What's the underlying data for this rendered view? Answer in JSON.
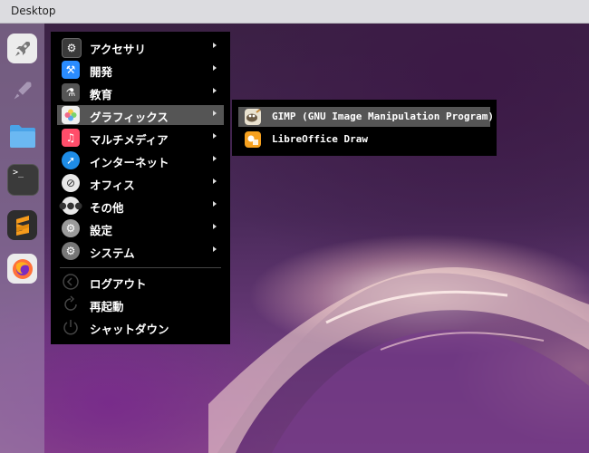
{
  "window": {
    "title": "Desktop"
  },
  "dock": {
    "items": [
      {
        "name": "launcher",
        "icon": "rocket-icon"
      },
      {
        "name": "rocket-ghost",
        "icon": "rocket-icon"
      },
      {
        "name": "files",
        "icon": "folder-icon"
      },
      {
        "name": "terminal",
        "icon": "terminal-icon",
        "glyph": ">_"
      },
      {
        "name": "sublime-text",
        "icon": "sublime-icon"
      },
      {
        "name": "firefox",
        "icon": "firefox-icon"
      }
    ]
  },
  "menu": {
    "items": [
      {
        "label": "アクセサリ",
        "icon": "accessories-icon",
        "color": "#3a3a3a"
      },
      {
        "label": "開発",
        "icon": "development-icon",
        "color": "#2a8cff"
      },
      {
        "label": "教育",
        "icon": "education-icon",
        "color": "#555"
      },
      {
        "label": "グラフィックス",
        "icon": "graphics-icon",
        "color": "#f0f0f0",
        "selected": true
      },
      {
        "label": "マルチメディア",
        "icon": "multimedia-icon",
        "color": "#ff4d6a"
      },
      {
        "label": "インターネット",
        "icon": "internet-icon",
        "color": "#1e8ce6"
      },
      {
        "label": "オフィス",
        "icon": "office-icon",
        "color": "#e8e8e8"
      },
      {
        "label": "その他",
        "icon": "more-icon",
        "color": "#e8e8e8"
      },
      {
        "label": "設定",
        "icon": "settings-icon",
        "color": "#9a9a9a"
      },
      {
        "label": "システム",
        "icon": "system-icon",
        "color": "#777"
      }
    ],
    "power": [
      {
        "label": "ログアウト",
        "icon": "logout-icon"
      },
      {
        "label": "再起動",
        "icon": "restart-icon"
      },
      {
        "label": "シャットダウン",
        "icon": "shutdown-icon"
      }
    ]
  },
  "submenu": {
    "items": [
      {
        "label": "GIMP (GNU Image Manipulation Program)",
        "icon": "gimp-icon",
        "selected": true
      },
      {
        "label": "LibreOffice Draw",
        "icon": "libreoffice-draw-icon"
      }
    ]
  }
}
